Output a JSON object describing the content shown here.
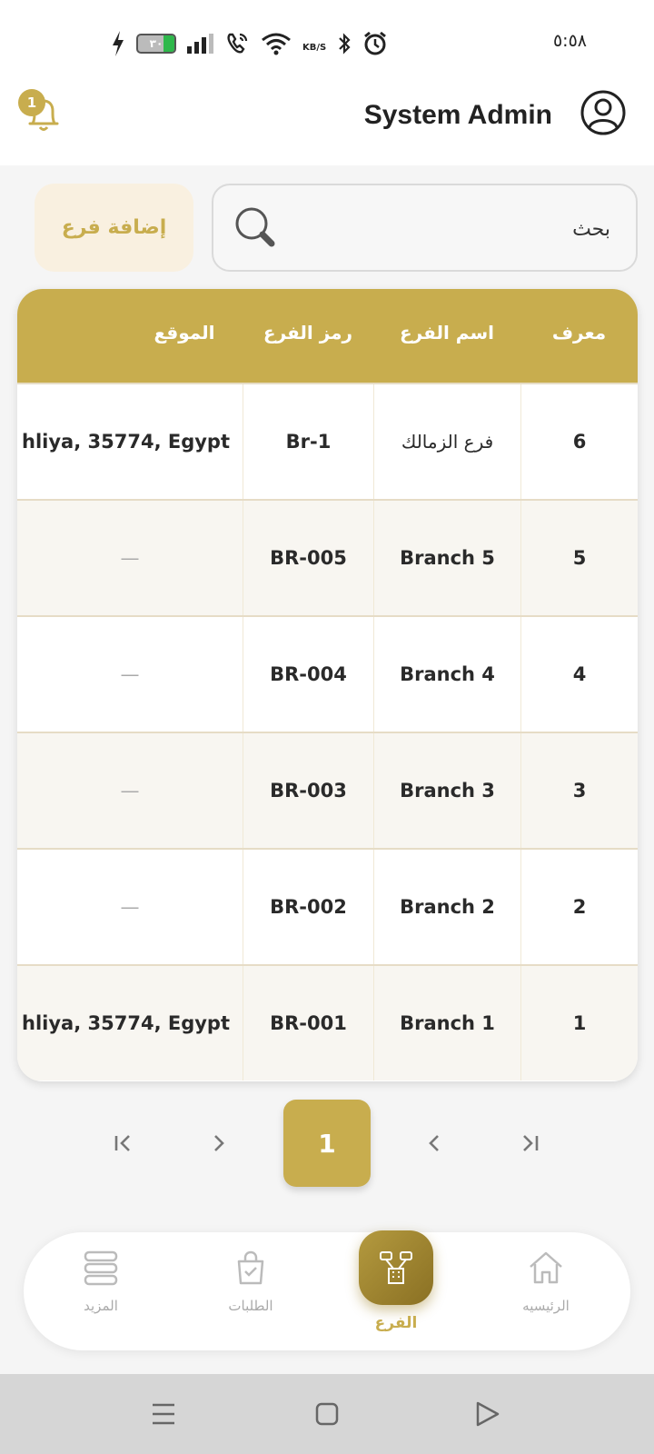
{
  "status_bar": {
    "battery_level": "٣٠",
    "speed_unit": "KB/S",
    "time": "٥:٥٨"
  },
  "header": {
    "notification_count": "1",
    "user_name": "System Admin"
  },
  "toolbar": {
    "add_branch_label": "إضافة فرع",
    "search_placeholder": "بحث"
  },
  "table": {
    "columns": {
      "id": "معرف",
      "name": "اسم الفرع",
      "code": "رمز الفرع",
      "location": "الموقع"
    },
    "rows": [
      {
        "id": "6",
        "name": "فرع الزمالك",
        "code": "Br-1",
        "location": "hliya, 35774, Egypt"
      },
      {
        "id": "5",
        "name": "Branch 5",
        "code": "BR-005",
        "location": "—"
      },
      {
        "id": "4",
        "name": "Branch 4",
        "code": "BR-004",
        "location": "—"
      },
      {
        "id": "3",
        "name": "Branch 3",
        "code": "BR-003",
        "location": "—"
      },
      {
        "id": "2",
        "name": "Branch 2",
        "code": "BR-002",
        "location": "—"
      },
      {
        "id": "1",
        "name": "Branch 1",
        "code": "BR-001",
        "location": "hliya, 35774, Egypt"
      }
    ]
  },
  "pagination": {
    "current_page": "1",
    "first_icon": "first-page-icon",
    "prev_icon": "chevron-right-icon",
    "next_icon": "chevron-left-icon",
    "last_icon": "last-page-icon"
  },
  "bottom_nav": {
    "items": [
      {
        "label": "المزيد",
        "icon": "menu-stack-icon"
      },
      {
        "label": "الطلبات",
        "icon": "shopping-bag-icon"
      },
      {
        "label": "الفرع",
        "icon": "branch-icon",
        "active": true
      },
      {
        "label": "الرئيسيه",
        "icon": "home-icon"
      }
    ]
  },
  "colors": {
    "accent": "#c8ad4e",
    "accent_light": "#f9f0e0",
    "row_alt": "#f8f6f1"
  }
}
